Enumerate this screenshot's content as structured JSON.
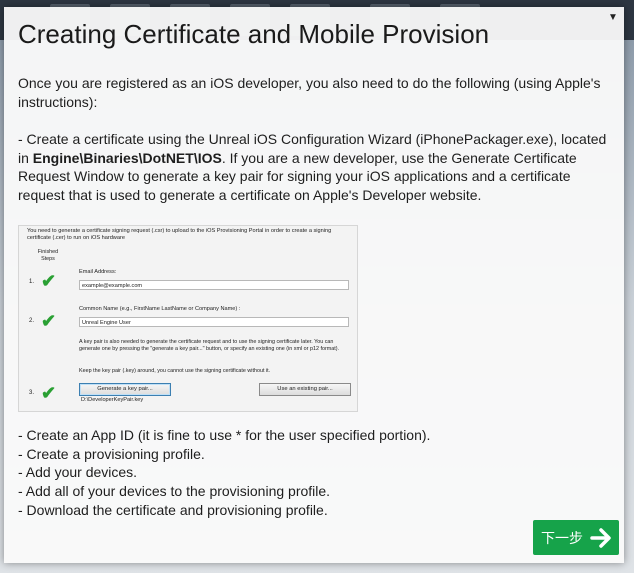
{
  "dialog": {
    "title": "Creating Certificate and Mobile Provision",
    "intro": "Once you are registered as an iOS developer, you also need to do the following (using Apple's instructions):",
    "step1_prefix": "- Create a certificate using the Unreal iOS Configuration Wizard (iPhonePackager.exe), located in ",
    "step1_path": "Engine\\Binaries\\DotNET\\IOS",
    "step1_suffix": ". If you are a new developer, use the Generate Certificate Request Window to generate a key pair for signing your iOS applications and a certificate request that is used to generate a certificate on Apple's Developer website.",
    "steps": [
      "- Create an App ID (it is fine to use * for the user specified portion).",
      "- Create a provisioning profile.",
      "- Add your devices.",
      "- Add all of your devices to the provisioning profile.",
      "- Download the certificate and provisioning profile."
    ],
    "next_label": "下一步"
  },
  "screenshot": {
    "intro": "You need to generate a certificate signing request (.csr) to upload to the iOS Provisioning Portal in order to create a signing certificate (.cer) to run on iOS hardware",
    "finished_steps": "Finished Steps",
    "num1": "1.",
    "num2": "2.",
    "num3": "3.",
    "email_label": "Email Address:",
    "email_value": "example@example.com",
    "name_label": "Common Name (e.g., FirstName LastName or Company Name) :",
    "name_value": "Unreal Engine User",
    "key_text": "A key pair is also needed to generate the certificate request and to use the signing certificate later. You can generate one by pressing the \"generate a key pair...\" button, or specify an existing one (in xml or p12 format).",
    "key_warning": "Keep the key pair (.key) around, you cannot use the signing certificate without it.",
    "gen_button": "Generate a key pair...",
    "existing_button": "Use an existing pair...",
    "key_path": "D:\\DeveloperKeyPair.key"
  },
  "icons": [
    "chevron-down-icon",
    "checkmark-icon",
    "arrow-right-icon"
  ],
  "colors": {
    "next_button": "#16a34a",
    "check": "#2aa033"
  }
}
